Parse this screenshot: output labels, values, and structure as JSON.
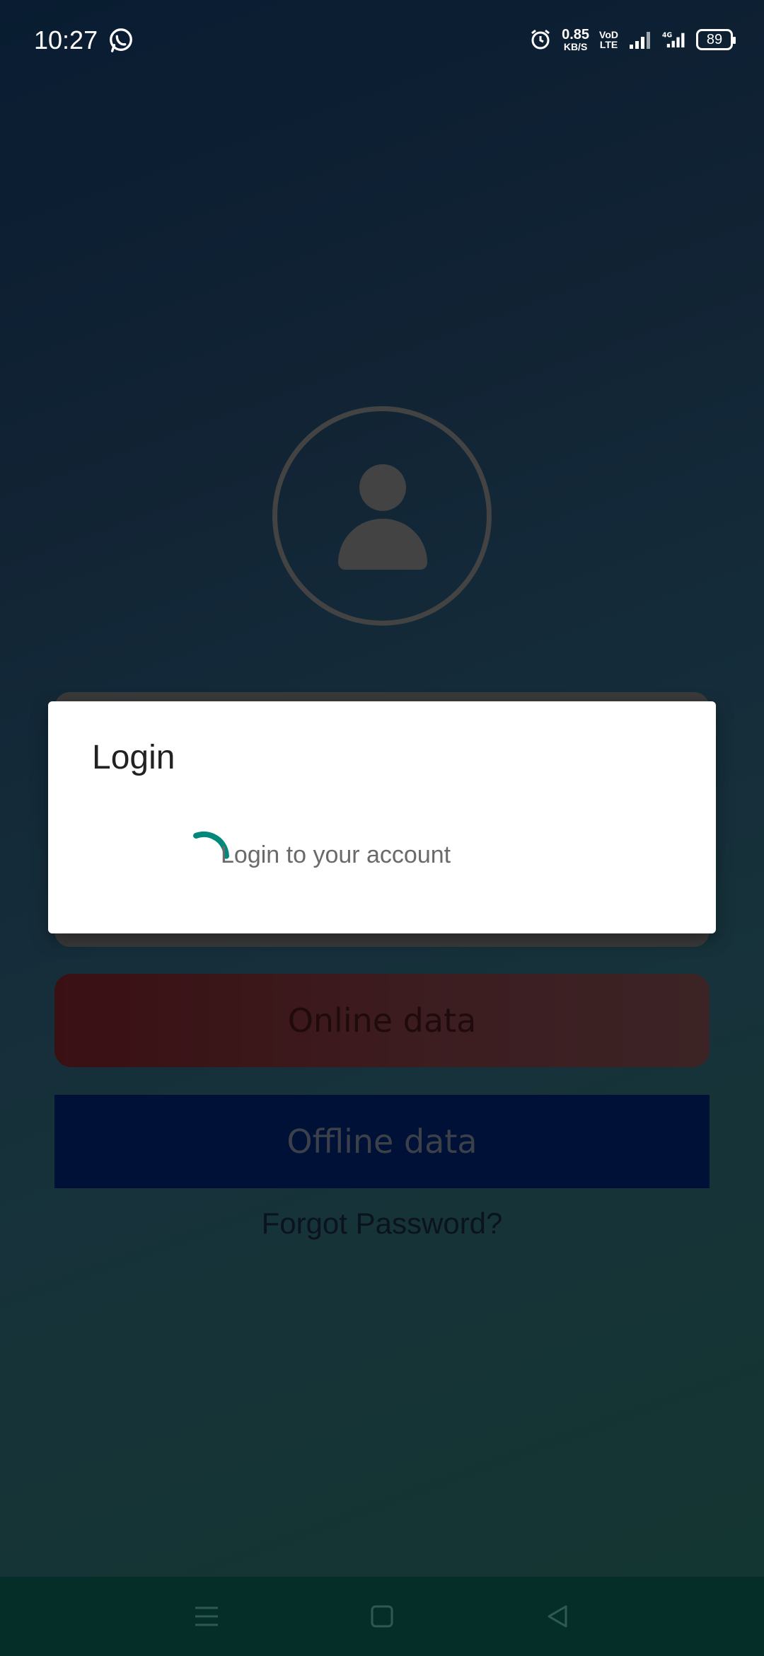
{
  "status_bar": {
    "time": "10:27",
    "speed_value": "0.85",
    "speed_unit": "KB/S",
    "volte_top": "VoD",
    "volte_bottom": "LTE",
    "network": "4G",
    "battery": "89"
  },
  "screen": {
    "online_button": "Online data",
    "offline_button": "Offline data",
    "forgot_password": "Forgot Password?"
  },
  "dialog": {
    "title": "Login",
    "message": "Login to your account"
  },
  "colors": {
    "spinner": "#00897b",
    "online_button": "#6a1e24",
    "offline_button": "#001f66"
  },
  "icons": {
    "status_left": "whatsapp-icon",
    "alarm": "alarm-icon",
    "avatar": "user-icon",
    "nav": [
      "menu-icon",
      "home-icon",
      "back-icon"
    ]
  }
}
